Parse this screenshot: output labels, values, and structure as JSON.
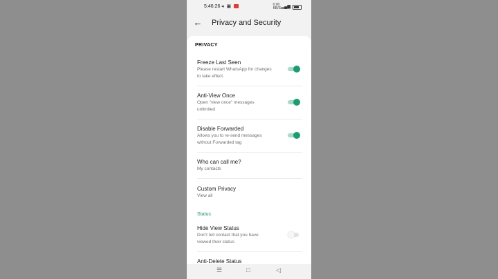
{
  "status_bar": {
    "time": "5:46:26",
    "right_top": "0.00",
    "right_bottom": "KB/S"
  },
  "app_bar": {
    "title": "Privacy and Security"
  },
  "privacy": {
    "header": "PRIVACY",
    "items": [
      {
        "title": "Freeze Last Seen",
        "subtitle": "Please restart WhatsApp for changes to take effect.",
        "toggle": "on"
      },
      {
        "title": "Anti-View Once",
        "subtitle": "Open \"view once\" messages unlimited",
        "toggle": "on"
      },
      {
        "title": "Disable Forwarded",
        "subtitle": "Allows you to re-send messages without Forwarded tag",
        "toggle": "on"
      },
      {
        "title": "Who can call me?",
        "subtitle": "My contacts"
      },
      {
        "title": "Custom Privacy",
        "subtitle": "View all"
      }
    ]
  },
  "status": {
    "header": "Status",
    "items": [
      {
        "title": "Hide View Status",
        "subtitle": "Don't tell contact that you have viewed their status",
        "toggle": "off"
      },
      {
        "title": "Anti-Delete Status"
      }
    ]
  },
  "colors": {
    "accent": "#1a9e6e",
    "background": "#8e8e8e",
    "surface": "#ffffff"
  },
  "icons": {
    "back": "arrow-left-icon",
    "nav": [
      "menu-icon",
      "home-square-icon",
      "back-triangle-icon"
    ]
  }
}
